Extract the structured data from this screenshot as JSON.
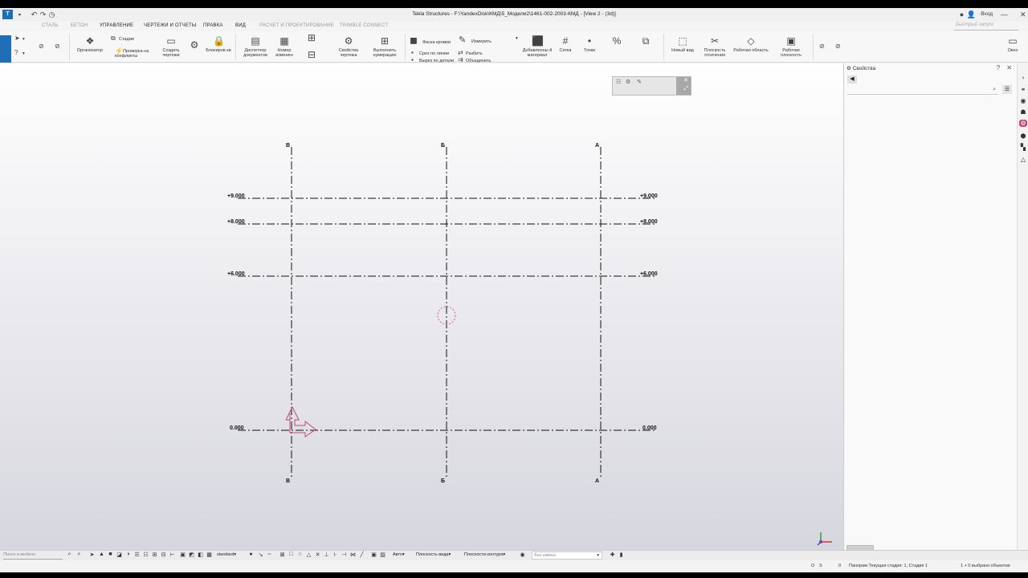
{
  "window": {
    "title": "Tekla Structures - F:\\YandexDisk\\КМД\\5_Модели2\\1461-002-2003-КМД - [View 2 - (3d)]",
    "login": "Вход"
  },
  "tabs": [
    {
      "label": "СТАЛЬ"
    },
    {
      "label": "БЕТОН"
    },
    {
      "label": "УПРАВЛЕНИЕ"
    },
    {
      "label": "ЧЕРТЕЖИ И ОТЧЕТЫ"
    },
    {
      "label": "ПРАВКА"
    },
    {
      "label": "ВИД"
    },
    {
      "label": "РАСЧЕТ И ПРОЕКТИРОВАНИЕ"
    },
    {
      "label": "TRIMBLE CONNECT"
    }
  ],
  "quick_launch": {
    "placeholder": "Быстрый запуск"
  },
  "ribbon": {
    "organizer": "Организатор",
    "stages": "Стадии",
    "clash_check": "Проверка на конфликты",
    "create_drawings": "Создать чертежи",
    "lock": "Блокиров ки",
    "doc_manager": "Диспетчер документов",
    "change_number": "Номер изменен",
    "drawing_props": "Свойства чертежа",
    "numbering": "Выполнить нумерацию",
    "chamfer": "Фаска кромки",
    "measure": "Измерить",
    "cut_line": "Срез по линии",
    "split": "Разбить",
    "cut_part": "Вырез по детали",
    "merge": "Объединить",
    "added_material": "Добавленны й материал",
    "grid": "Сетка",
    "points": "Точки",
    "new_view": "Новый вид",
    "clip_planes": "Плоскость отсечения",
    "work_area": "Рабочая область",
    "work_plane": "Рабочая плоскость",
    "window": "Окно"
  },
  "viewport": {
    "grid_x_labels_top": [
      "В",
      "Б",
      "А"
    ],
    "grid_x_labels_bottom": [
      "В",
      "Б",
      "А"
    ],
    "levels": [
      "+9.000",
      "+8.000",
      "+6.000",
      "0.000"
    ],
    "levels_right": [
      "+9.000",
      "+8.000",
      "+6.000",
      "0.000"
    ]
  },
  "properties": {
    "title": "Свойства"
  },
  "bottom_toolbar": {
    "search_placeholder": "Поиск в модели",
    "standard": "standard",
    "auto": "Авто",
    "view_plane": "Плоскость вида",
    "contour_plane": "Плоскости контура",
    "name_placeholder": "Без имени"
  },
  "status": {
    "o": "O",
    "s": "S",
    "zero": "0",
    "phase": "Панорам Текущая стадия: 1, Стадия 1",
    "selected": "1 + 0 выбрано объектов:"
  },
  "colors": {
    "accent": "#1f6fb7",
    "gizmo": "#c44a6e",
    "grid_line": "#111111"
  }
}
